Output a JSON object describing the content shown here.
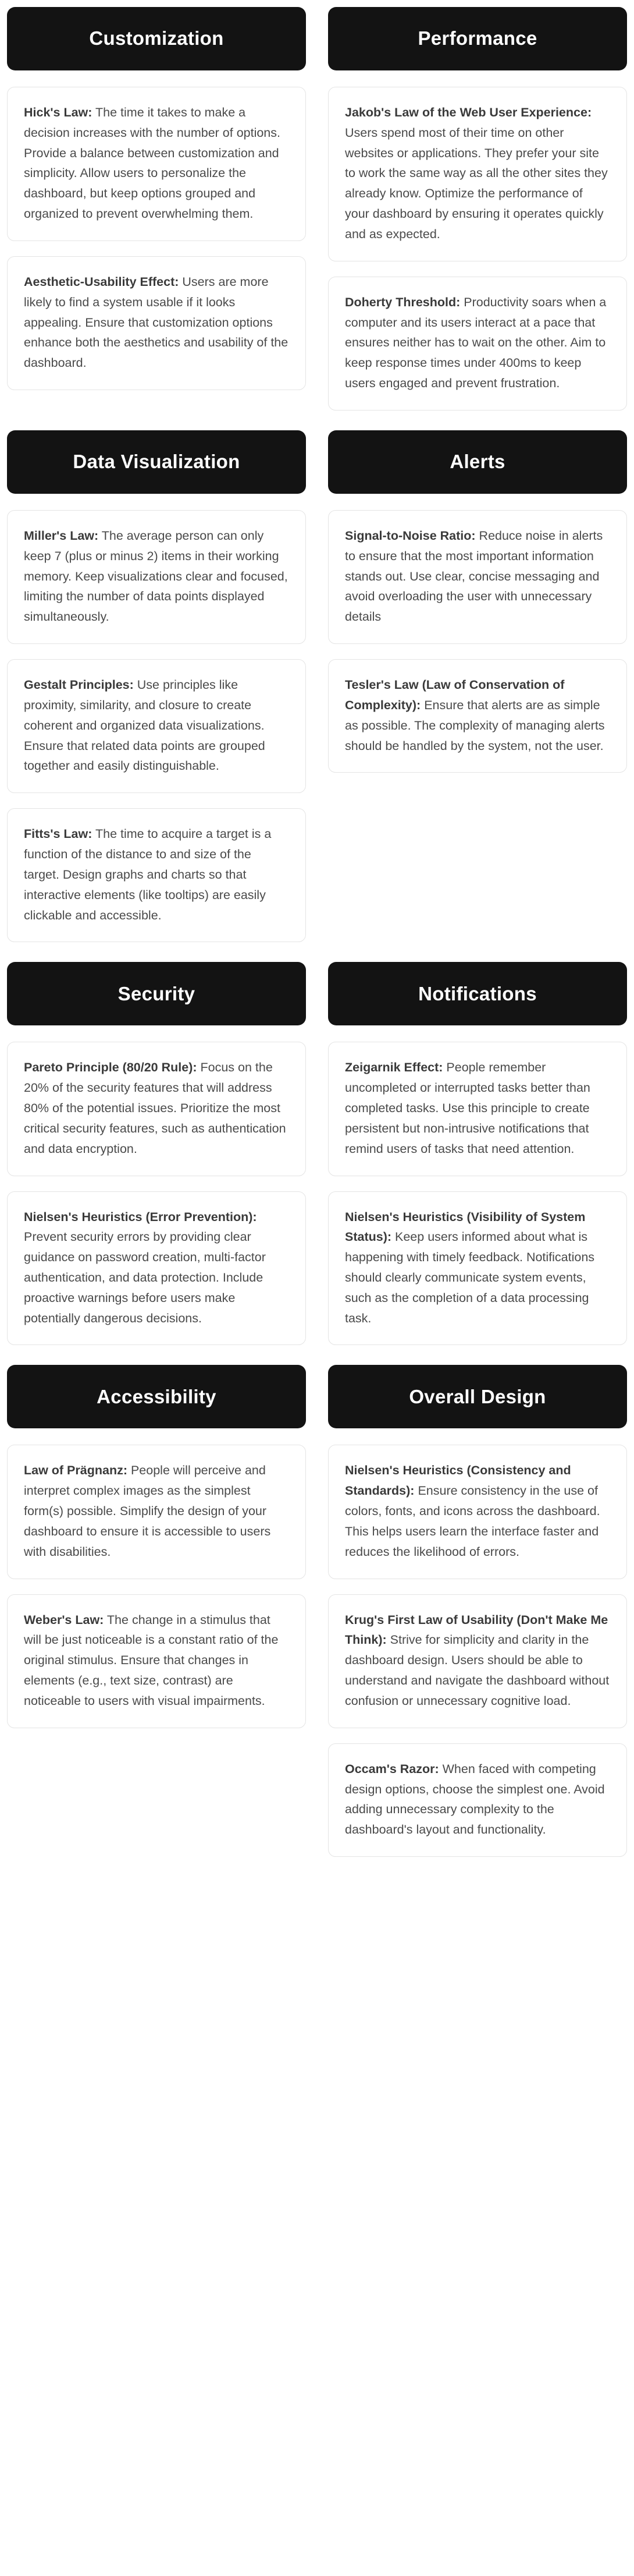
{
  "page": {
    "title": "Dashboard UX Laws Reference Board",
    "layout": "two-column-grid",
    "header_bg": "#131313",
    "header_text_color": "#ffffff",
    "card_bg": "#ffffff",
    "card_border": "#e4e4e4",
    "body_text_color": "#4a4a4a"
  },
  "sections": [
    {
      "columns": [
        {
          "header": "Customization",
          "cards": [
            {
              "term": "Hick's Law:",
              "body": " The time it takes to make a decision increases with the number of options. Provide a balance between customization and simplicity. Allow users to personalize the dashboard, but keep options grouped and organized to prevent overwhelming them."
            },
            {
              "term": "Aesthetic-Usability Effect:",
              "body": " Users are more likely to find a system usable if it looks appealing. Ensure that customization options enhance both the aesthetics and usability of the dashboard."
            }
          ]
        },
        {
          "header": "Performance",
          "cards": [
            {
              "term": "Jakob's Law of the Web User Experience:",
              "body": " Users spend most of their time on other websites or applications. They prefer your site to work the same way as all the other sites they already know. Optimize the performance of your dashboard by ensuring it operates quickly and as expected."
            },
            {
              "term": "Doherty Threshold:",
              "body": " Productivity soars when a computer and its users interact at a pace that ensures neither has to wait on the other. Aim to keep response times under 400ms to keep users engaged and prevent frustration."
            }
          ]
        }
      ]
    },
    {
      "columns": [
        {
          "header": "Data Visualization",
          "cards": [
            {
              "term": "Miller's Law:",
              "body": " The average person can only keep 7 (plus or minus 2) items in their working memory. Keep visualizations clear and focused, limiting the number of data points displayed simultaneously."
            },
            {
              "term": "Gestalt Principles:",
              "body": " Use principles like proximity, similarity, and closure to create coherent and organized data visualizations. Ensure that related data points are grouped together and easily distinguishable."
            },
            {
              "term": "Fitts's Law:",
              "body": " The time to acquire a target is a function of the distance to and size of the target. Design graphs and charts so that interactive elements (like tooltips) are easily clickable and accessible."
            }
          ]
        },
        {
          "header": "Alerts",
          "cards": [
            {
              "term": "Signal-to-Noise Ratio:",
              "body": " Reduce noise in alerts to ensure that the most important information stands out. Use clear, concise messaging and avoid overloading the user with unnecessary details"
            },
            {
              "term": "Tesler's Law (Law of Conservation of Complexity):",
              "body": " Ensure that alerts are as simple as possible. The complexity of managing alerts should be handled by the system, not the user."
            }
          ]
        }
      ]
    },
    {
      "columns": [
        {
          "header": "Security",
          "cards": [
            {
              "term": "Pareto Principle (80/20 Rule):",
              "body": " Focus on the 20% of the security features that will address 80% of the potential issues. Prioritize the most critical security features, such as authentication and data encryption."
            },
            {
              "term": "Nielsen's Heuristics (Error Prevention):",
              "body": " Prevent security errors by providing clear guidance on password creation, multi-factor authentication, and data protection. Include proactive warnings before users make potentially dangerous decisions."
            }
          ]
        },
        {
          "header": "Notifications",
          "cards": [
            {
              "term": "Zeigarnik Effect:",
              "body": " People remember uncompleted or interrupted tasks better than completed tasks. Use this principle to create persistent but non-intrusive notifications that remind users of tasks that need attention."
            },
            {
              "term": "Nielsen's Heuristics (Visibility of System Status):",
              "body": " Keep users informed about what is happening with timely feedback. Notifications should clearly communicate system events, such as the completion of a data processing task."
            }
          ]
        }
      ]
    },
    {
      "columns": [
        {
          "header": "Accessibility",
          "cards": [
            {
              "term": "Law of Prägnanz:",
              "body": " People will perceive and interpret complex images as the simplest form(s) possible. Simplify the design of your dashboard to ensure it is accessible to users with disabilities."
            },
            {
              "term": "Weber's Law:",
              "body": " The change in a stimulus that will be just noticeable is a constant ratio of the original stimulus. Ensure that changes in elements (e.g., text size, contrast) are noticeable to users with visual impairments."
            }
          ]
        },
        {
          "header": "Overall Design",
          "cards": [
            {
              "term": "Nielsen's Heuristics (Consistency and Standards):",
              "body": " Ensure consistency in the use of colors, fonts, and icons across the dashboard. This helps users learn the interface faster and reduces the likelihood of errors."
            },
            {
              "term": "Krug's First Law of Usability (Don't Make Me Think):",
              "body": " Strive for simplicity and clarity in the dashboard design. Users should be able to understand and navigate the dashboard without confusion or unnecessary cognitive load."
            },
            {
              "term": "Occam's Razor:",
              "body": " When faced with competing design options, choose the simplest one. Avoid adding unnecessary complexity to the dashboard's layout and functionality."
            }
          ]
        }
      ]
    }
  ]
}
